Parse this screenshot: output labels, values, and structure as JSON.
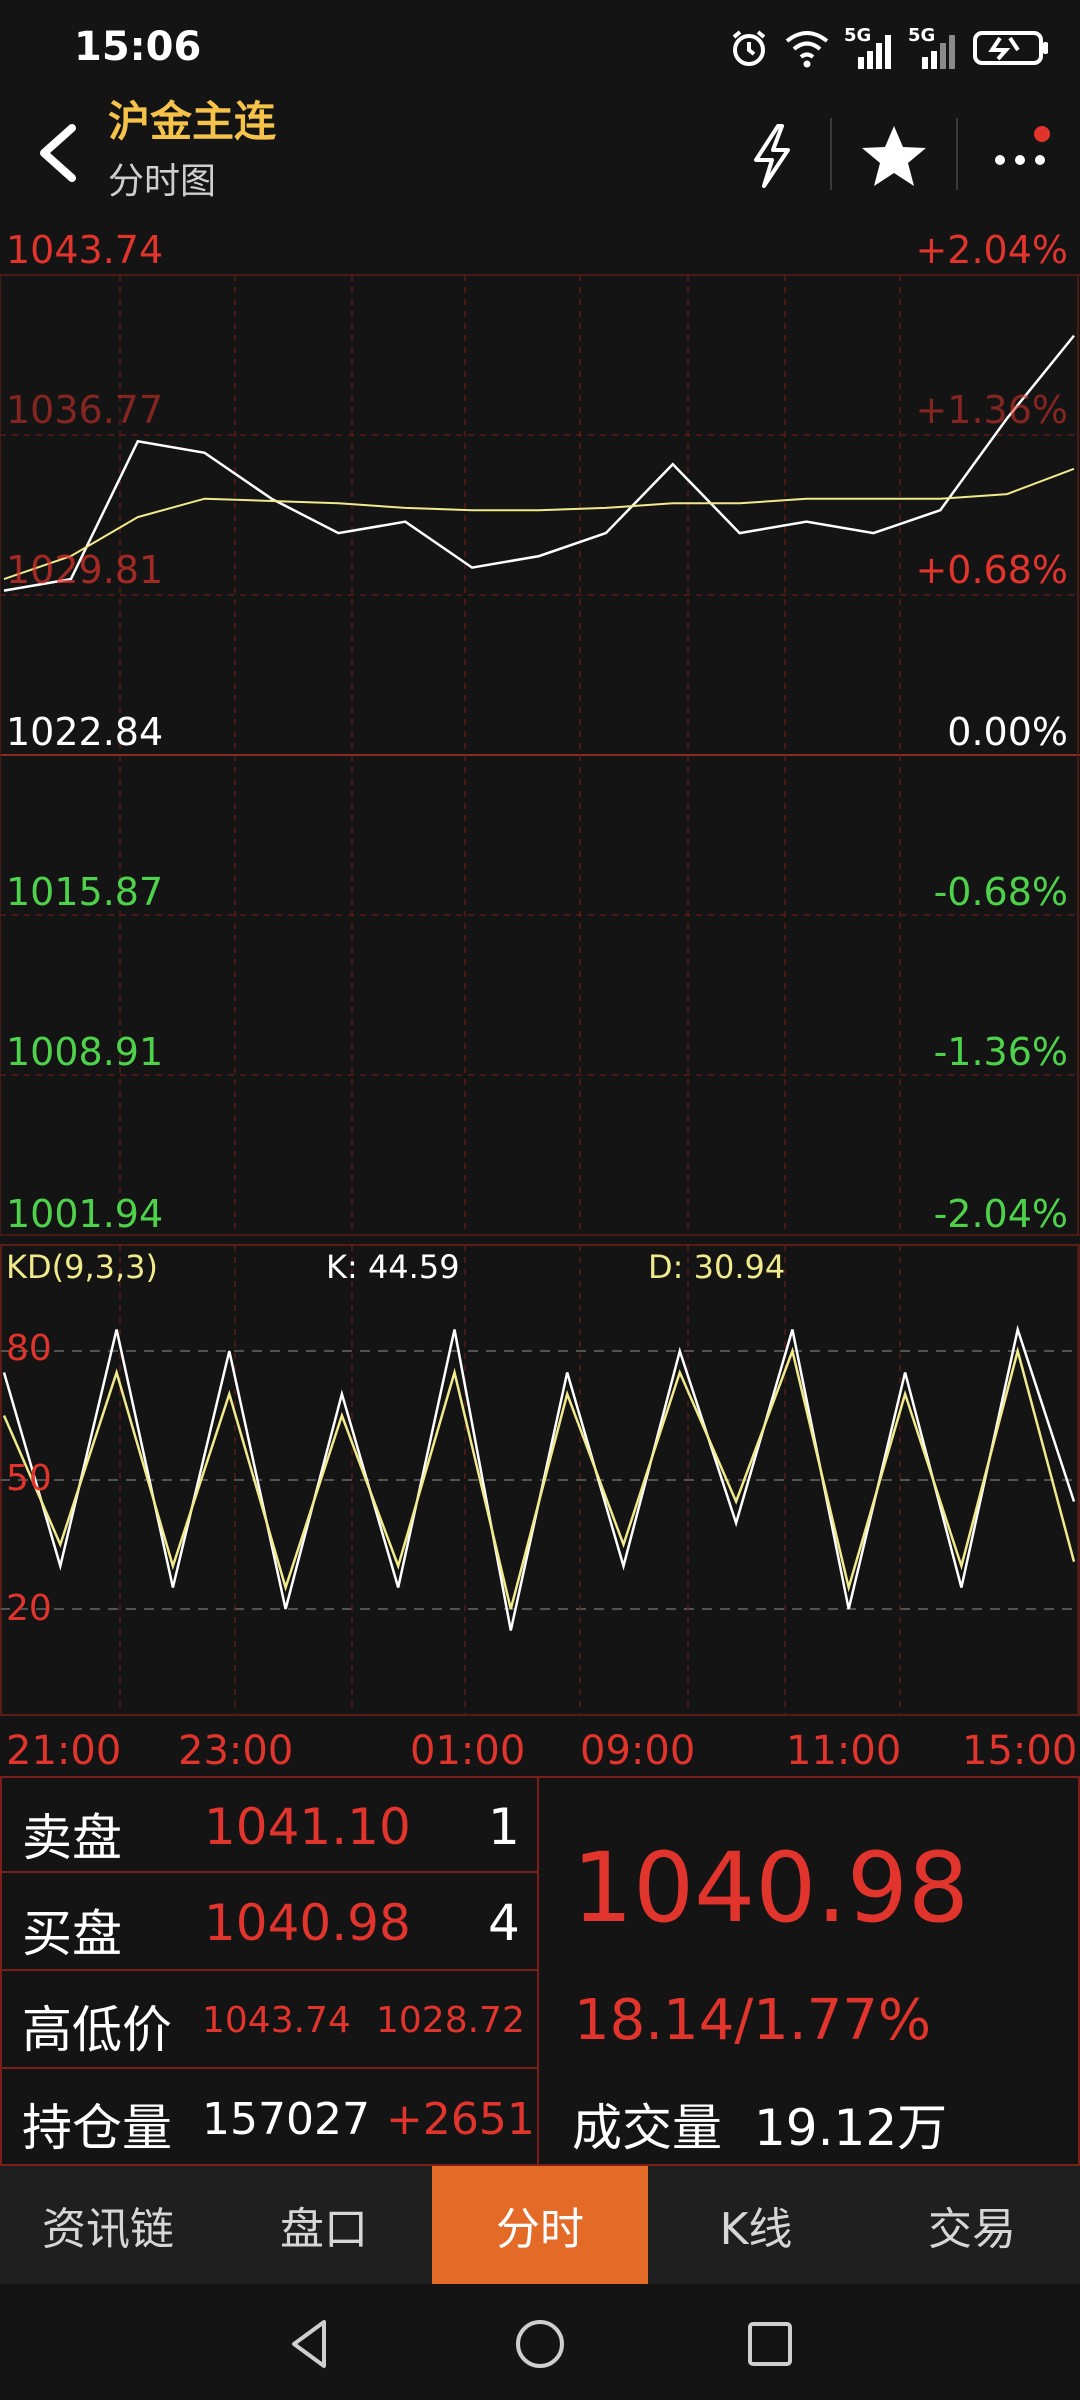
{
  "status_bar": {
    "time": "15:06",
    "net1": "5G",
    "net2": "5G"
  },
  "header": {
    "title": "沪金主连",
    "subtitle": "分时图"
  },
  "price_chart": {
    "left_labels": [
      "1043.74",
      "1036.77",
      "1029.81",
      "1022.84",
      "1015.87",
      "1008.91",
      "1001.94"
    ],
    "right_labels": [
      "+2.04%",
      "+1.36%",
      "+0.68%",
      "0.00%",
      "-0.68%",
      "-1.36%",
      "-2.04%"
    ],
    "colors": {
      "up": "#e0342c",
      "down": "#4fd24b",
      "neutral": "#ffffff",
      "avg": "#f0ea8c"
    }
  },
  "kd": {
    "name": "KD(9,3,3)",
    "k_label": "K: 44.59",
    "d_label": "D: 30.94",
    "levels": [
      "80",
      "50",
      "20"
    ]
  },
  "time_axis": [
    "21:00",
    "23:00",
    "01:00",
    "09:00",
    "11:00",
    "15:00"
  ],
  "quote_panel": {
    "sell_label": "卖盘",
    "sell_price": "1041.10",
    "sell_vol": "1",
    "buy_label": "买盘",
    "buy_price": "1040.98",
    "buy_vol": "4",
    "hilo_label": "高低价",
    "high": "1043.74",
    "low": "1028.72",
    "oi_label": "持仓量",
    "oi": "157027",
    "oi_change": "+2651",
    "last_price": "1040.98",
    "change": "18.14/1.77%",
    "volume_label": "成交量",
    "volume": "19.12万"
  },
  "tabs": [
    {
      "label": "资讯链"
    },
    {
      "label": "盘口"
    },
    {
      "label": "分时",
      "active": true
    },
    {
      "label": "K线"
    },
    {
      "label": "交易"
    }
  ],
  "chart_data": {
    "type": "line",
    "title": "沪金主连 分时图",
    "x": [
      "21:00",
      "23:00",
      "01:00",
      "09:00",
      "11:00",
      "15:00"
    ],
    "ylim": [
      1001.94,
      1043.74
    ],
    "series": [
      {
        "values": [
          1030.0,
          1030.5,
          1036.5,
          1036.0,
          1034.0,
          1032.5,
          1033.0,
          1031.0,
          1031.5,
          1032.5,
          1035.5,
          1032.5,
          1033.0,
          1032.5,
          1033.5,
          1037.5,
          1041.1
        ]
      },
      {
        "values": [
          1030.5,
          1031.5,
          1033.2,
          1034.0,
          1033.9,
          1033.8,
          1033.6,
          1033.5,
          1033.5,
          1033.6,
          1033.8,
          1033.8,
          1034.0,
          1034.0,
          1034.0,
          1034.2,
          1035.3
        ]
      }
    ],
    "kd_series": [
      {
        "name": "K",
        "values": [
          75,
          30,
          85,
          25,
          80,
          20,
          70,
          25,
          85,
          15,
          75,
          30,
          80,
          40,
          85,
          20,
          75,
          25,
          85,
          45
        ]
      },
      {
        "name": "D",
        "values": [
          65,
          35,
          75,
          30,
          70,
          25,
          65,
          30,
          75,
          20,
          70,
          35,
          75,
          45,
          80,
          25,
          70,
          30,
          80,
          31
        ]
      }
    ]
  }
}
